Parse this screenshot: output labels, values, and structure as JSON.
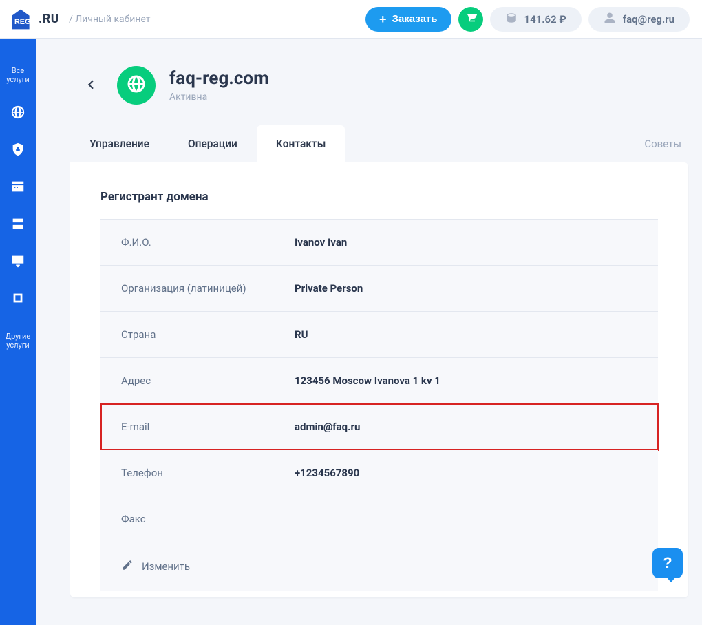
{
  "header": {
    "logo_text": ".RU",
    "breadcrumb": "/ Личный кабинет",
    "order_label": "Заказать",
    "balance": "141.62 ₽",
    "account_email": "faq@reg.ru"
  },
  "sidebar": {
    "all": "Все\nуслуги",
    "other": "Другие\nуслуги"
  },
  "page": {
    "domain_name": "faq-reg.com",
    "domain_status": "Активна",
    "tabs": {
      "management": "Управление",
      "operations": "Операции",
      "contacts": "Контакты"
    },
    "tips": "Советы"
  },
  "contacts": {
    "section_title": "Регистрант домена",
    "rows": {
      "fullname": {
        "label": "Ф.И.О.",
        "value": "Ivanov Ivan"
      },
      "org": {
        "label": "Организация (латиницей)",
        "value": "Private Person"
      },
      "country": {
        "label": "Страна",
        "value": "RU"
      },
      "address": {
        "label": "Адрес",
        "value": "123456 Moscow Ivanova 1 kv 1"
      },
      "email": {
        "label": "E-mail",
        "value": "admin@faq.ru"
      },
      "phone": {
        "label": "Телефон",
        "value": "+1234567890"
      },
      "fax": {
        "label": "Факс",
        "value": ""
      }
    },
    "edit_label": "Изменить"
  },
  "help_fab": "?"
}
